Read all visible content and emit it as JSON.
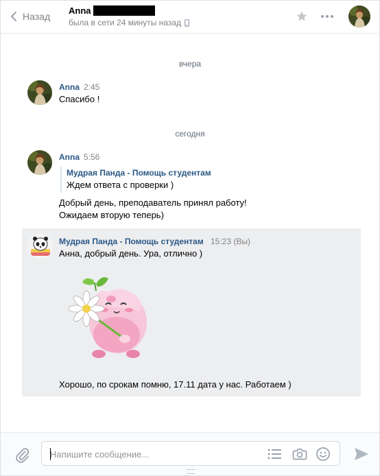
{
  "header": {
    "back_label": "Назад",
    "peer_name": "Anna",
    "peer_status": "была в сети 24 минуты назад"
  },
  "dividers": {
    "yesterday": "вчера",
    "today": "сегодня"
  },
  "messages": [
    {
      "author": "Anna",
      "time": "2:45",
      "text": "Спасибо !"
    },
    {
      "author": "Anna",
      "time": "5:56",
      "quote_author": "Мудрая Панда - Помощь студентам",
      "quote_text": "Ждем ответа с проверки )",
      "lines": [
        "Добрый день, преподаватель принял работу!",
        "Ожидаем вторую теперь)"
      ]
    },
    {
      "author": "Мудрая Панда - Помощь студентам",
      "time": "15:23 (Вы)",
      "text": "Анна, добрый день. Ура, отлично )",
      "after_sticker": "Хорошо, по срокам помню, 17.11 дата у нас. Работаем )"
    }
  ],
  "composer": {
    "placeholder": "Напишите сообщение..."
  },
  "colors": {
    "link": "#2a5885",
    "selected_bg": "#edeef0",
    "send": "#aeb7c2"
  }
}
